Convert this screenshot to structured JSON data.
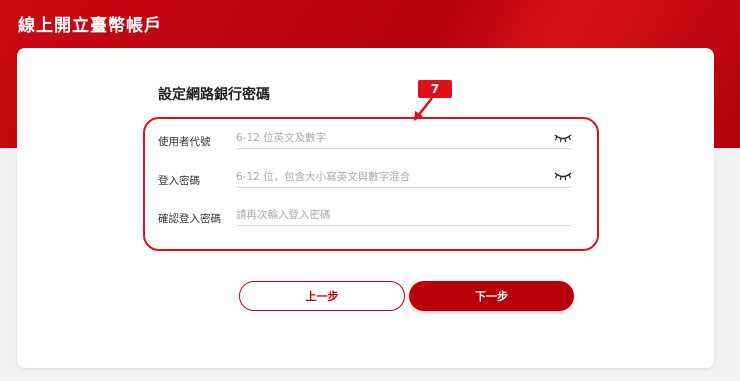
{
  "header": {
    "title": "線上開立臺幣帳戶"
  },
  "section": {
    "title": "設定網路銀行密碼"
  },
  "annotation": {
    "label": "7",
    "color": "#e0101b"
  },
  "form": {
    "rows": [
      {
        "label": "使用者代號",
        "placeholder": "6-12 位英文及數字",
        "value": "",
        "icon": "eye-closed-icon"
      },
      {
        "label": "登入密碼",
        "placeholder": "6-12 位，包含大小寫英文與數字混合",
        "value": "",
        "icon": "eye-closed-icon"
      },
      {
        "label": "確認登入密碼",
        "placeholder": "請再次輸入登入密碼",
        "value": ""
      }
    ]
  },
  "buttons": {
    "prev_label": "上一步",
    "next_label": "下一步"
  },
  "colors": {
    "brand": "#c4000d",
    "hero": "#c80a14",
    "background": "#f1f1f1"
  }
}
